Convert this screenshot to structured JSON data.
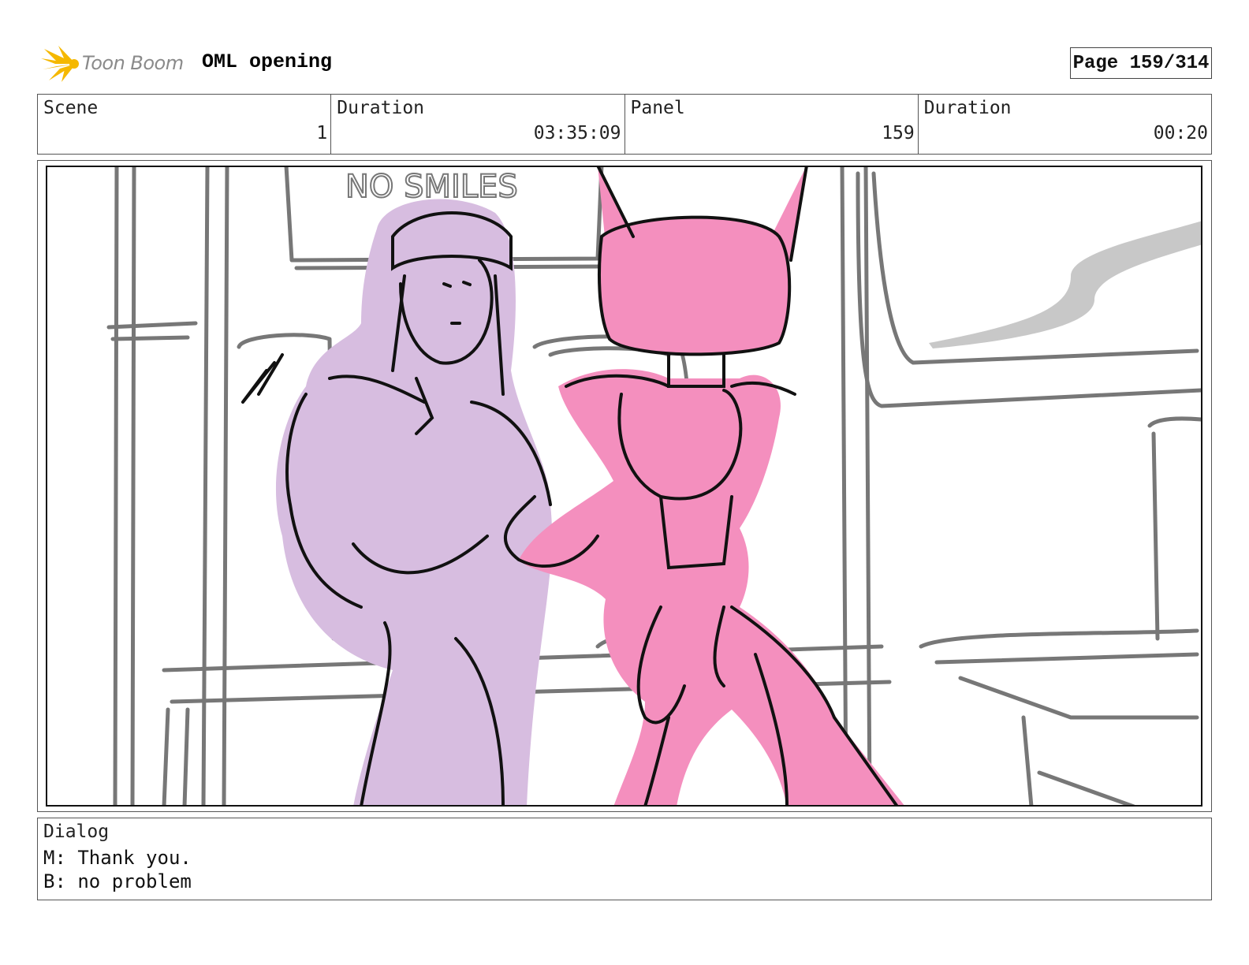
{
  "header": {
    "brand": "Toon Boom",
    "title": "OML opening",
    "page": "Page 159/314"
  },
  "info": [
    {
      "label": "Scene",
      "value": "1"
    },
    {
      "label": "Duration",
      "value": "03:35:09"
    },
    {
      "label": "Panel",
      "value": "159"
    },
    {
      "label": "Duration",
      "value": "00:20"
    }
  ],
  "panel": {
    "sign_text": "NO SMILES",
    "colors": {
      "sketch": "#777777",
      "girl_fill": "#d7bde0",
      "robot_fill": "#f48fbe",
      "ink": "#111111",
      "logo": "#f5b800"
    }
  },
  "dialog": {
    "label": "Dialog",
    "lines": [
      "M: Thank you.",
      "B: no problem"
    ]
  }
}
